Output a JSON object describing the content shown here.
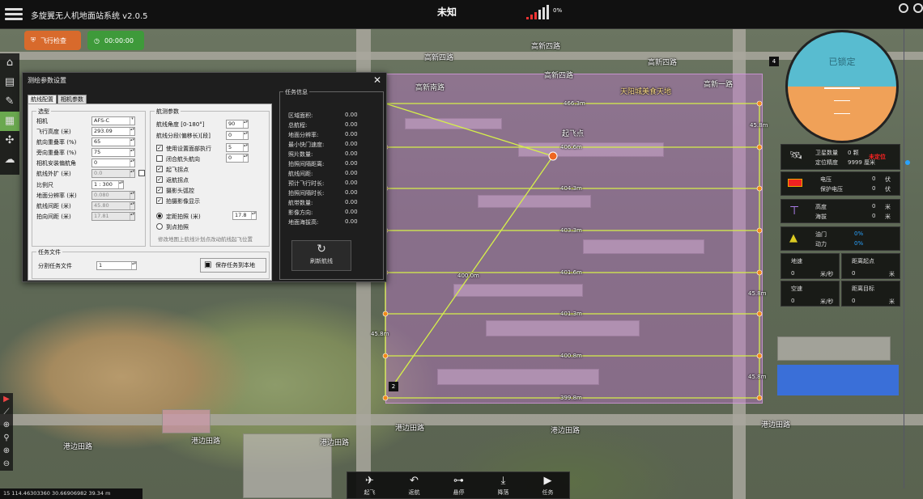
{
  "app": {
    "title": "多旋翼无人机地面站系统 v2.0.5",
    "status": "未知",
    "signal_pct": "0%"
  },
  "chips": {
    "flight_check": "飞行检查",
    "timer": "00:00:00"
  },
  "left_tools": [
    "home-icon",
    "print-icon",
    "edit-icon",
    "grid-icon",
    "drone-icon",
    "cloud-icon"
  ],
  "dialog": {
    "title": "测绘参数设置",
    "tabs": [
      "航线配置",
      "相机参数"
    ],
    "camera_group": "选型",
    "route_group": "航测参数",
    "fields_left": [
      {
        "label": "相机",
        "value": "AFS-C",
        "disabled": false
      },
      {
        "label": "飞行高度 (米)",
        "value": "293.09",
        "disabled": false
      },
      {
        "label": "航向重叠率 (%)",
        "value": "65",
        "disabled": false
      },
      {
        "label": "旁向重叠率 (%)",
        "value": "75",
        "disabled": false
      },
      {
        "label": "相机安装偏航角",
        "value": "0",
        "disabled": false
      },
      {
        "label": "航线外扩 (米)",
        "value": "0.0",
        "disabled": true
      },
      {
        "label": "比例尺",
        "value": "1 : 300",
        "disabled": false
      },
      {
        "label": "地面分辨率 (米)",
        "value": "0.080",
        "disabled": true
      },
      {
        "label": "航线间距 (米)",
        "value": "45.80",
        "disabled": true
      },
      {
        "label": "拍向间距 (米)",
        "value": "17.81",
        "disabled": true
      }
    ],
    "fields_right": [
      {
        "label": "航线角度 [0-180°]",
        "value": "90"
      },
      {
        "label": "航线分段(偏移长)[段]",
        "value": "0"
      }
    ],
    "checks": [
      {
        "label": "使用设置面部执行",
        "checked": true,
        "value": "5"
      },
      {
        "label": "闭合航头航向",
        "checked": false,
        "value": "0"
      },
      {
        "label": "起飞拐点",
        "checked": true
      },
      {
        "label": "返航拐点",
        "checked": true
      },
      {
        "label": "摄影头弧控",
        "checked": true
      },
      {
        "label": "拍摄影像显示",
        "checked": true
      }
    ],
    "radios": [
      {
        "label": "定距拍照 (米)",
        "on": true,
        "value": "17.8"
      },
      {
        "label": "到点拍照",
        "on": false
      }
    ],
    "note": "修改地图上航线计划点改动航线起飞位置",
    "mission_file_group": "任务文件",
    "split_label": "分割任务文件",
    "split_value": "1",
    "save_button": "保存任务到本地",
    "info_title": "任务信息",
    "info_rows": [
      {
        "k": "区域面积:",
        "v": "0.00"
      },
      {
        "k": "总航程:",
        "v": "0.00"
      },
      {
        "k": "地面分辨率:",
        "v": "0.00"
      },
      {
        "k": "最小快门速度:",
        "v": "0.00"
      },
      {
        "k": "照片数量:",
        "v": "0.00"
      },
      {
        "k": "拍照间隔距离:",
        "v": "0.00"
      },
      {
        "k": "航线间距:",
        "v": "0.00"
      },
      {
        "k": "预计飞行时长:",
        "v": "0.00"
      },
      {
        "k": "拍照间隔时长:",
        "v": "0.00"
      },
      {
        "k": "航带数量:",
        "v": "0.00"
      },
      {
        "k": "影像方向:",
        "v": "0.00"
      },
      {
        "k": "地面海拔高:",
        "v": "0.00"
      }
    ],
    "refresh": "刷新航线"
  },
  "attitude": {
    "label": "已锁定"
  },
  "telemetry": {
    "sat_label": "卫星数量",
    "sat_value": "0 颗",
    "pos_label": "定位精度",
    "pos_value": "9999 厘米",
    "pos_status": "未定位",
    "volt_label": "电压",
    "volt_value": "0",
    "volt_unit": "伏",
    "prot_label": "保护电压",
    "prot_value": "0",
    "prot_unit": "伏",
    "alt_label": "高度",
    "alt_value": "0",
    "alt_unit": "米",
    "sea_label": "海拔",
    "sea_value": "0",
    "sea_unit": "米",
    "thr_label": "油门",
    "thr_value": "0%",
    "pwr_label": "动力",
    "pwr_value": "0%",
    "gs_label": "地速",
    "gs_value": "0",
    "gs_unit": "米/秒",
    "dh_label": "距离起点",
    "dh_value": "0",
    "dh_unit": "米",
    "as_label": "空速",
    "as_value": "0",
    "as_unit": "米/秒",
    "dt_label": "距离目标",
    "dt_value": "0",
    "dt_unit": "米"
  },
  "map": {
    "takeoff_label": "起飞点",
    "roads": [
      "高新四路",
      "高新四路",
      "高新四路",
      "高新四路",
      "港边田路",
      "港边田路",
      "港边田路",
      "港边田路",
      "港边田路",
      "港边田路",
      "高新南路",
      "高新一路"
    ],
    "poi": "天阳城美食天地",
    "distances": [
      "466.3m",
      "406.6m",
      "404.3m",
      "403.3m",
      "401.6m",
      "400.0m",
      "401.3m",
      "400.8m",
      "399.8m"
    ],
    "side_dist": [
      "45.8m",
      "45.8m",
      "45.8m",
      "45.8m"
    ],
    "wp_numbers": [
      "4",
      "2"
    ]
  },
  "bottom": [
    "起飞",
    "返航",
    "悬停",
    "降落",
    "任务"
  ],
  "coords": "15  114.46303360 30.66906982    39.34 m"
}
